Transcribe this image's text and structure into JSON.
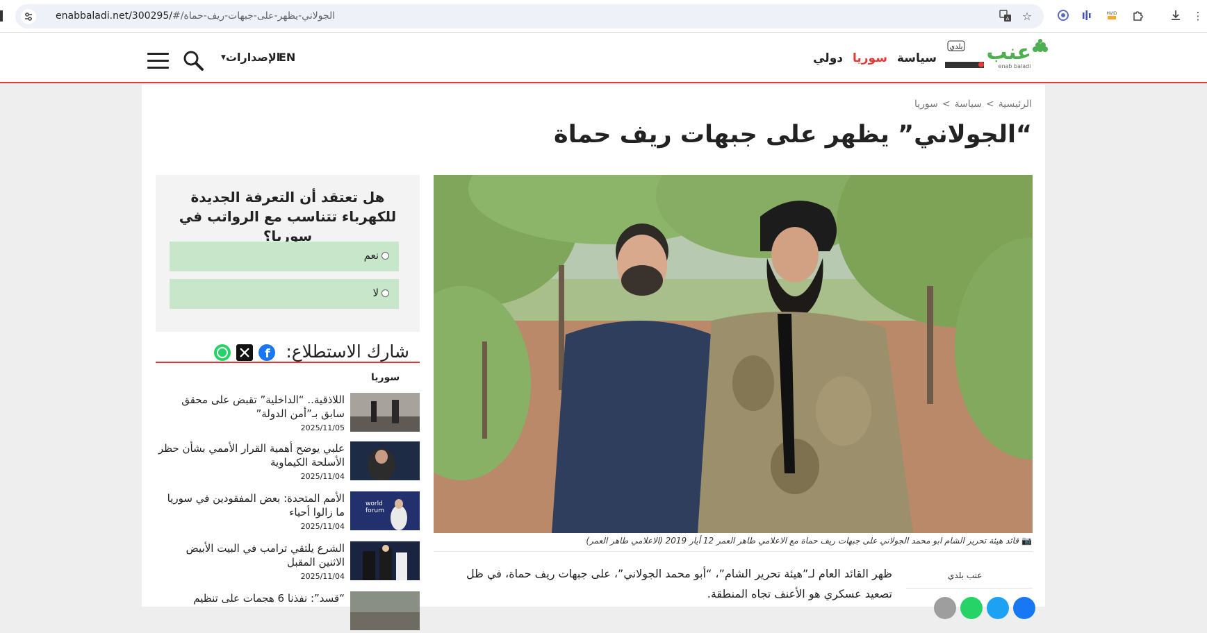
{
  "browser": {
    "url_domain": "enabbaladi.net/300295/",
    "url_path": "#/الجولاني-يظهر-على-جبهات-ريف-حماة"
  },
  "header": {
    "lang": "EN",
    "issues": "الإصدارات",
    "nav": [
      "سياسة",
      "سوريا",
      "دولي"
    ],
    "logo_text": "عنب",
    "logo_sub": "بلدي",
    "logo_latin": "enab baladi"
  },
  "breadcrumb": [
    "الرئيسية",
    ">",
    "سياسة",
    ">",
    "سوريا"
  ],
  "article": {
    "title": "“الجولاني” يظهر على جبهات ريف حماة",
    "caption": "قائد هيئة تحرير الشام ابو محمد الجولاني على جبهات ريف حماة مع الاعلامي طاهر العمر 12 أيار 2019 (الاعلامي طاهر العمر)",
    "body": "ظهر القائد العام لـ”هيئة تحرير الشام”، “أبو محمد الجولاني”، على جبهات ريف حماة، في ظل تصعيد عسكري هو الأعنف تجاه المنطقة.",
    "author": "عنب بلدي"
  },
  "poll": {
    "question": "هل تعتقد أن التعرفة الجديدة للكهرباء تتناسب مع الرواتب في سوريا؟",
    "options": [
      "نعم",
      "لا"
    ],
    "share_label": "شارك الاستطلاع:"
  },
  "sidebar_news": {
    "section": "سوريا",
    "items": [
      {
        "title": "اللاذقية.. “الداخلية” تقبض على محقق سابق بـ”أمن الدولة”",
        "date": "2025/11/05"
      },
      {
        "title": "علبي يوضح أهمية القرار الأممي بشأن حظر الأسلحة الكيماوية",
        "date": "2025/11/04"
      },
      {
        "title": "الأمم المتحدة: بعض المفقودين في سوريا ما زالوا أحياء",
        "date": "2025/11/04"
      },
      {
        "title": "الشرع يلتقي ترامب في البيت الأبيض الاثنين المقبل",
        "date": "2025/11/04"
      },
      {
        "title": "“قسد”: نفذنا 6 هجمات على تنظيم",
        "date": ""
      }
    ]
  },
  "colors": {
    "accent": "#e53935",
    "poll_option": "#c8e6c9",
    "logo_green": "#4caf50"
  }
}
